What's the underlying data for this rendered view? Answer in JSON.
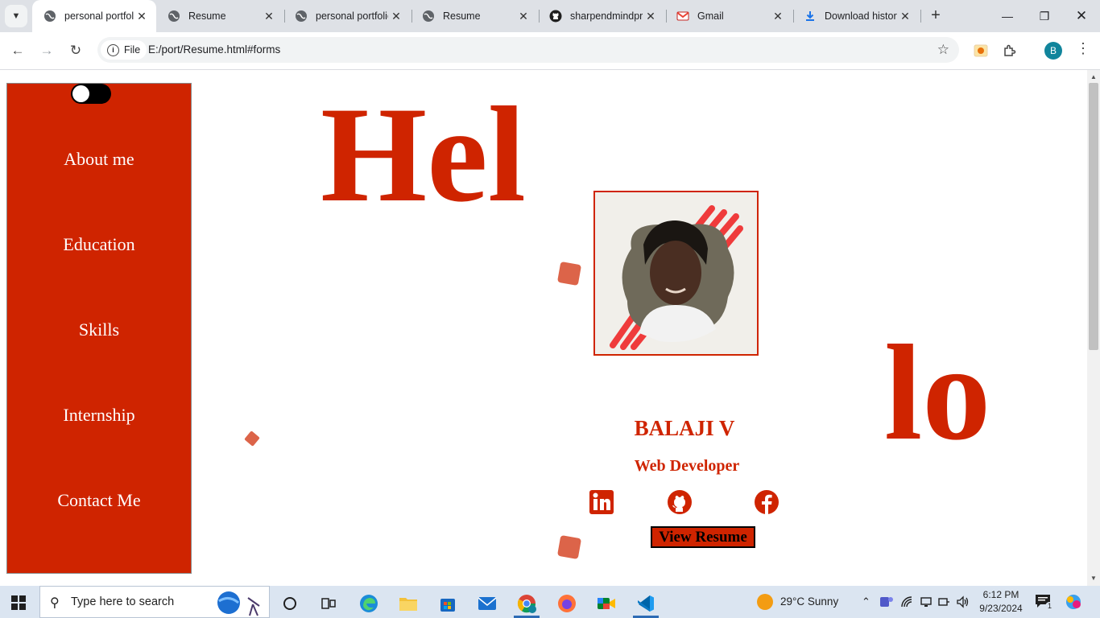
{
  "browser": {
    "tabs": [
      {
        "title": "personal portfolio",
        "icon": "globe-icon",
        "active": true
      },
      {
        "title": "Resume",
        "icon": "globe-icon",
        "active": false
      },
      {
        "title": "personal portfolio",
        "icon": "globe-icon",
        "active": false
      },
      {
        "title": "Resume",
        "icon": "globe-icon",
        "active": false
      },
      {
        "title": "sharpendmindpro",
        "icon": "github-icon",
        "active": false
      },
      {
        "title": "Gmail",
        "icon": "gmail-icon",
        "active": false
      },
      {
        "title": "Download history",
        "icon": "download-icon",
        "active": false
      }
    ],
    "site_chip": "File",
    "url": "E:/port/Resume.html#forms",
    "profile_initial": "B"
  },
  "sidebar": {
    "items": [
      {
        "label": "About me"
      },
      {
        "label": "Education"
      },
      {
        "label": "Skills"
      },
      {
        "label": "Internship"
      },
      {
        "label": "Contact Me"
      }
    ]
  },
  "hero": {
    "big_left": "Hel",
    "big_right": "lo",
    "name": "BALAJI V",
    "role": "Web Developer",
    "button_label": "View Resume",
    "social": [
      "linkedin-icon",
      "github-icon",
      "facebook-icon"
    ]
  },
  "colors": {
    "accent": "#cf2400",
    "deco": "#dc6449",
    "sidebar_text": "#ffffff"
  },
  "taskbar": {
    "search_placeholder": "Type here to search",
    "weather": "29°C  Sunny",
    "time": "6:12 PM",
    "date": "9/23/2024",
    "notification_count": "1"
  }
}
